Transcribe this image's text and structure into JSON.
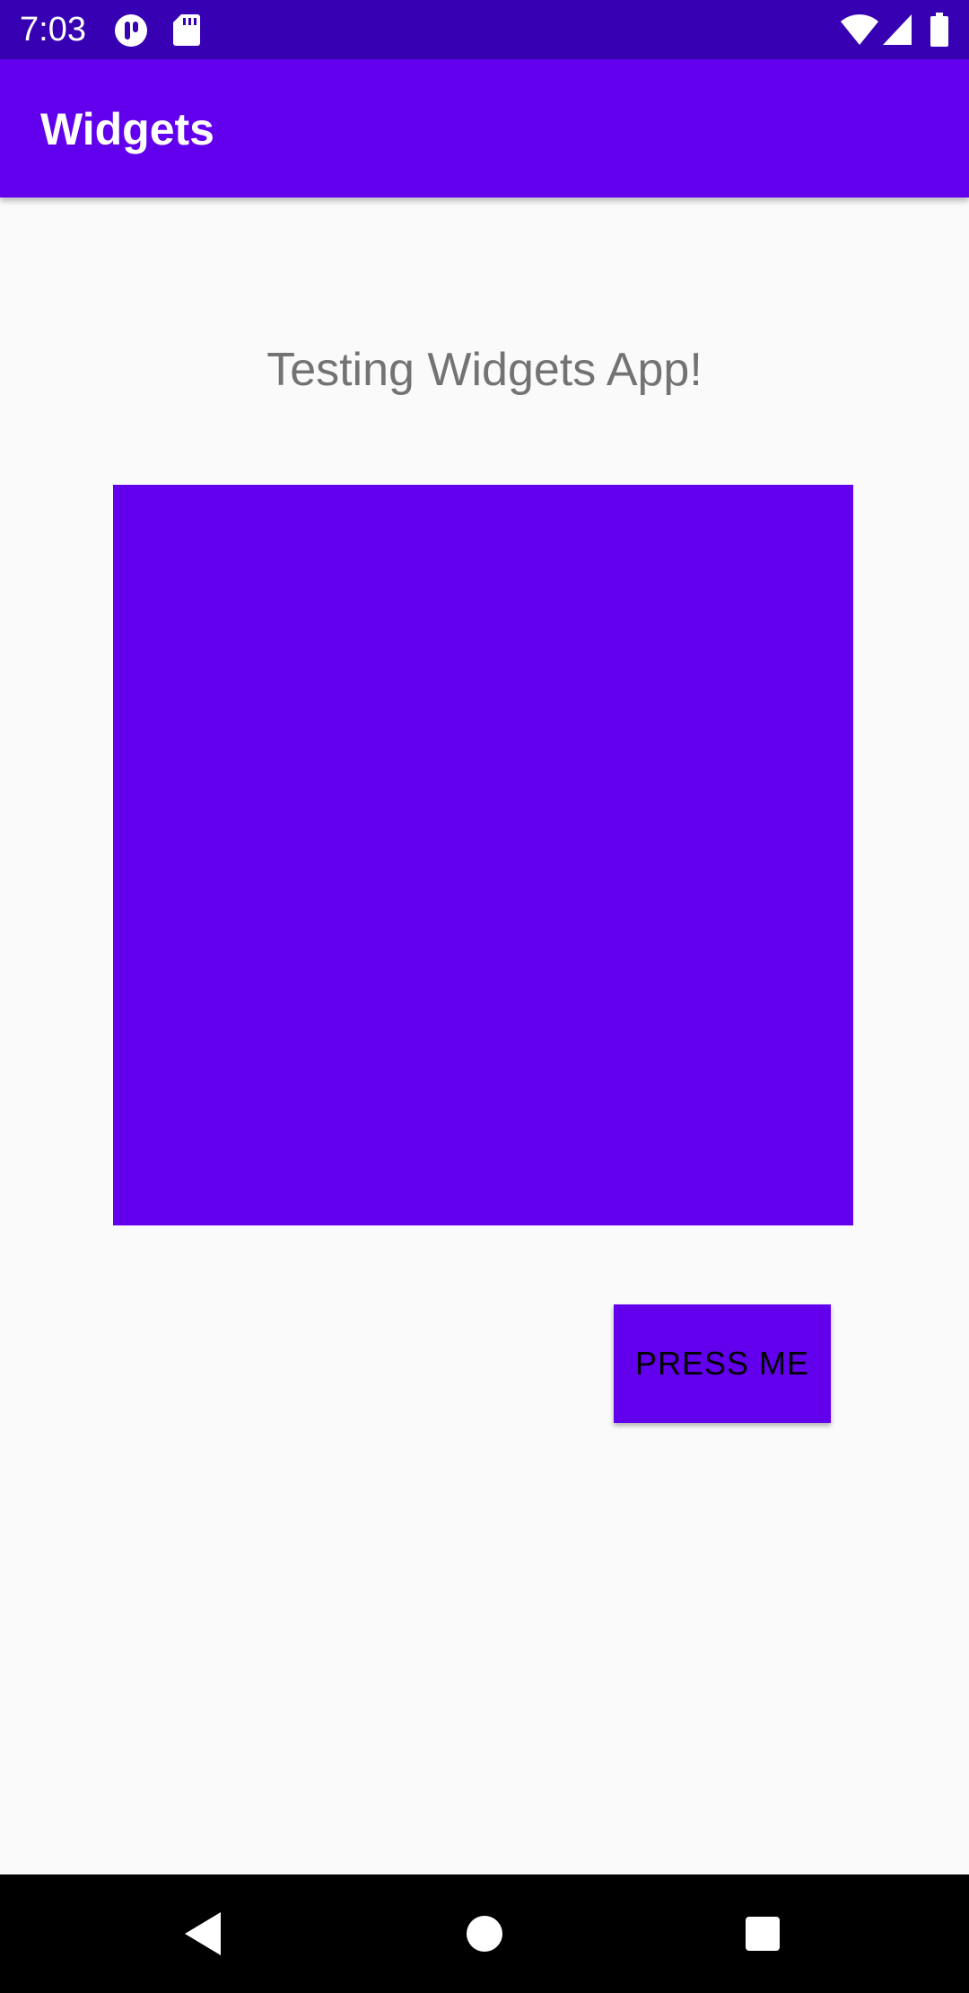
{
  "status_bar": {
    "time": "7:03",
    "icons": [
      "notification-app-icon",
      "sd-card-icon",
      "wifi-icon",
      "signal-icon",
      "battery-icon"
    ]
  },
  "app_bar": {
    "title": "Widgets"
  },
  "main": {
    "heading": "Testing Widgets App!",
    "button_label": "PRESS ME"
  },
  "nav_bar": {
    "buttons": [
      "back",
      "home",
      "recents"
    ]
  },
  "colors": {
    "primary": "#6200ee",
    "primary_dark": "#3700b3",
    "background": "#fafafa",
    "heading_text": "#737373"
  }
}
